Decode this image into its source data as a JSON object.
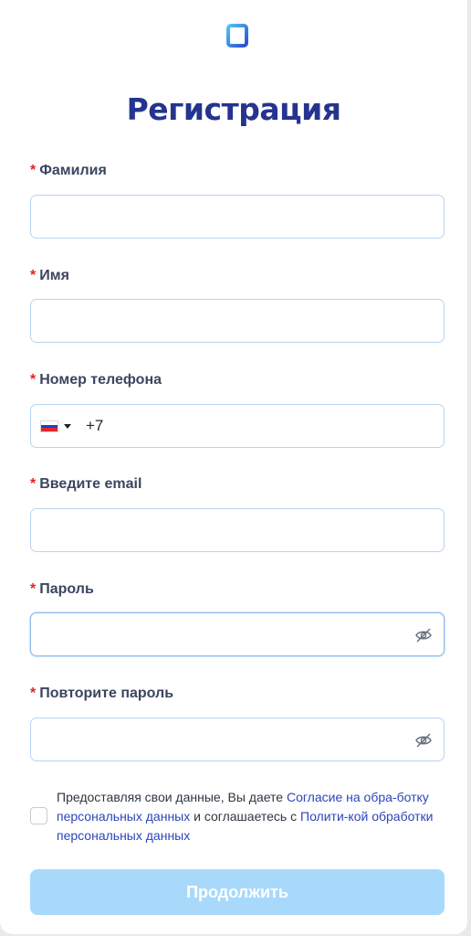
{
  "page_title": "Регистрация",
  "fields": [
    {
      "label": "Фамилия",
      "required_mark": "*",
      "value": ""
    },
    {
      "label": "Имя",
      "required_mark": "*",
      "value": ""
    },
    {
      "label": "Номер телефона",
      "required_mark": "*",
      "value": "",
      "country": "RU",
      "prefix": "+7"
    },
    {
      "label": "Введите email",
      "required_mark": "*",
      "value": ""
    },
    {
      "label": "Пароль",
      "required_mark": "*",
      "value": "",
      "icon": "eye-slash-icon"
    },
    {
      "label": "Повторите пароль",
      "required_mark": "*",
      "value": "",
      "icon": "eye-slash-icon"
    }
  ],
  "consent": {
    "checked": false,
    "text_1": "Предоставляя свои данные, Вы даете ",
    "link_1": "Согласие на обра-ботку персональных данных",
    "text_2": " и соглашаетесь с ",
    "link_2": "Полити-кой обработки персональных данных"
  },
  "submit_label": "Продолжить",
  "colors": {
    "title": "#25348f",
    "required": "#e02424",
    "border": "#b8d4f3",
    "link": "#2c45b8",
    "button_disabled": "#a8d9fb"
  }
}
